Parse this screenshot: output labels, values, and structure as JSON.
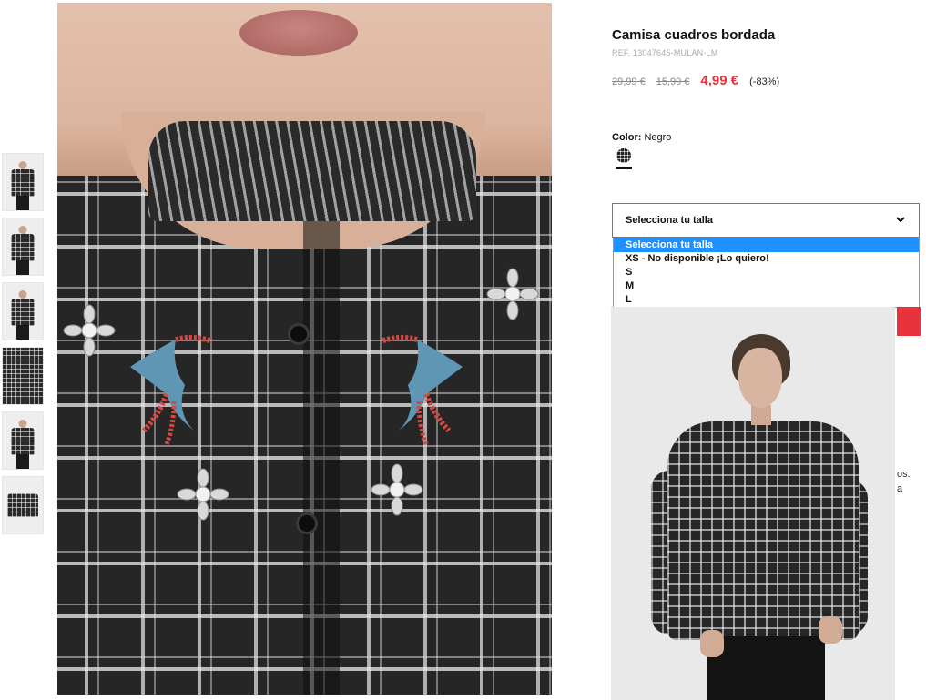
{
  "product": {
    "title": "Camisa cuadros bordada",
    "ref": "REF. 13047645-MULAN-LM",
    "price_original": "29,99 €",
    "price_previous": "15,99 €",
    "price_current": "4,99 €",
    "discount": "(-83%)"
  },
  "color": {
    "label": "Color:",
    "value": "Negro"
  },
  "size": {
    "select_label": "Selecciona tu talla",
    "options": [
      "Selecciona tu talla",
      "XS - No disponible ¡Lo quiero!",
      "S",
      "M",
      "L"
    ],
    "selected_index": 0
  },
  "truncated_text": {
    "line1": "os.",
    "line2": "a"
  },
  "thumbnails": [
    {
      "name": "thumbnail-1"
    },
    {
      "name": "thumbnail-2"
    },
    {
      "name": "thumbnail-3"
    },
    {
      "name": "thumbnail-4"
    },
    {
      "name": "thumbnail-5"
    },
    {
      "name": "thumbnail-6"
    }
  ],
  "colors": {
    "sale_red": "#e8323c",
    "highlight_blue": "#1e90ff",
    "text_dark": "#111111",
    "text_muted": "#aaaaaa"
  }
}
